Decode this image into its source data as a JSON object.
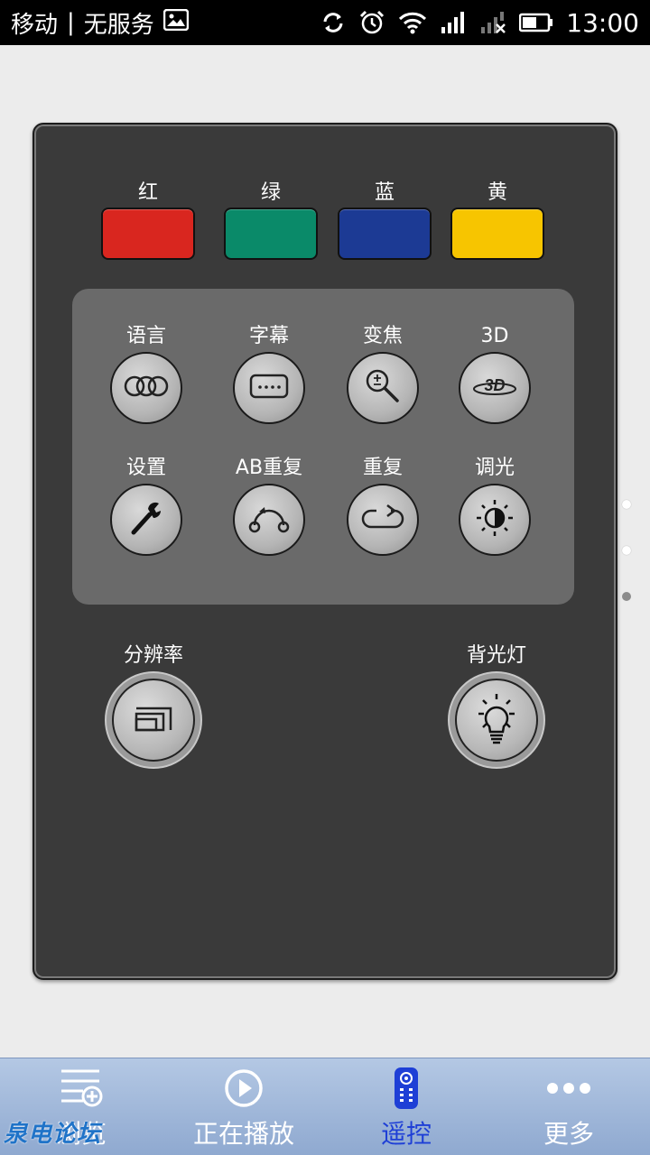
{
  "status_bar": {
    "carrier": "移动",
    "separator": "|",
    "service": "无服务",
    "time": "13:00",
    "icons": [
      "image-icon",
      "sync-icon",
      "alarm-icon",
      "wifi-icon",
      "signal-icon",
      "no-signal-icon",
      "battery-icon"
    ]
  },
  "color_buttons": [
    {
      "label": "红",
      "color": "#d9261f"
    },
    {
      "label": "绿",
      "color": "#0a8a69"
    },
    {
      "label": "蓝",
      "color": "#1c3a94"
    },
    {
      "label": "黄",
      "color": "#f7c500"
    }
  ],
  "function_buttons": [
    {
      "label": "语言",
      "icon": "language-icon"
    },
    {
      "label": "字幕",
      "icon": "subtitle-icon"
    },
    {
      "label": "变焦",
      "icon": "zoom-icon"
    },
    {
      "label": "3D",
      "icon": "3d-icon"
    },
    {
      "label": "设置",
      "icon": "wrench-icon"
    },
    {
      "label": "AB重复",
      "icon": "ab-repeat-icon"
    },
    {
      "label": "重复",
      "icon": "repeat-icon"
    },
    {
      "label": "调光",
      "icon": "dimmer-icon"
    }
  ],
  "big_buttons": [
    {
      "label": "分辨率",
      "icon": "resolution-icon"
    },
    {
      "label": "背光灯",
      "icon": "backlight-bulb-icon"
    }
  ],
  "page_indicator": {
    "total": 3,
    "current": 3
  },
  "bottom_nav": [
    {
      "label": "浏览",
      "icon": "browse-list-icon",
      "active": false
    },
    {
      "label": "正在播放",
      "icon": "play-circle-icon",
      "active": false
    },
    {
      "label": "遥控",
      "icon": "remote-icon",
      "active": true
    },
    {
      "label": "更多",
      "icon": "more-dots-icon",
      "active": false
    }
  ],
  "watermark": "泉电论坛",
  "colors": {
    "accent": "#1e3fd6",
    "panel": "#3a3a3a",
    "nav_bg": "#a4bbdd"
  }
}
